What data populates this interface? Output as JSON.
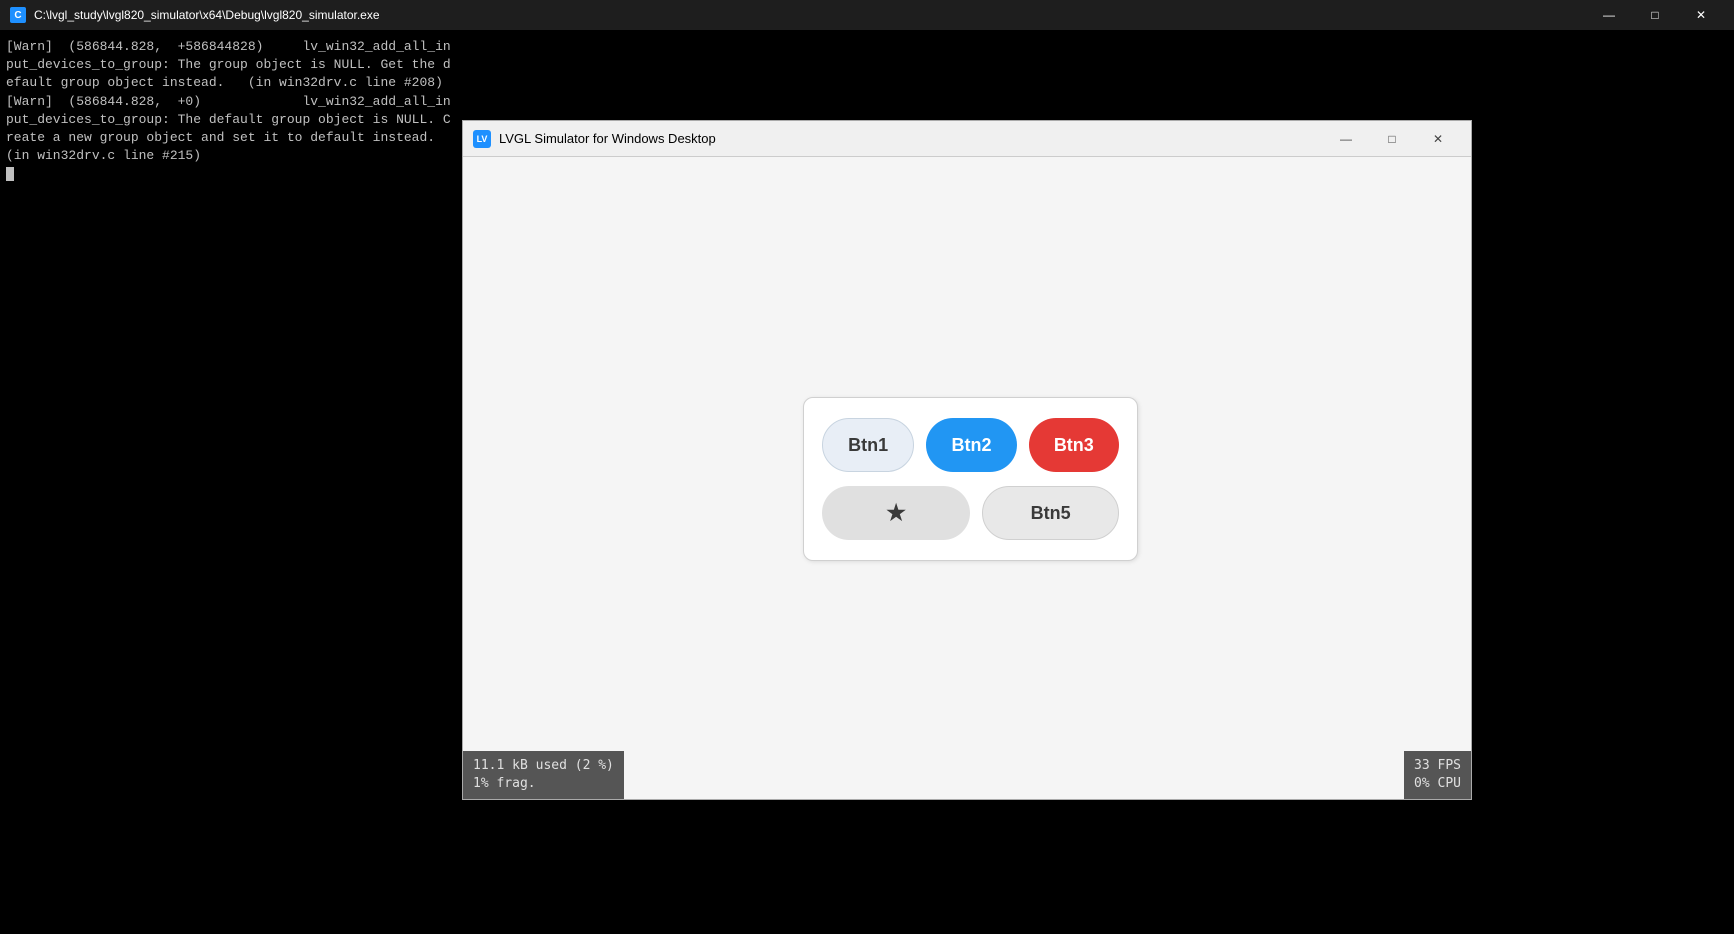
{
  "console": {
    "titlebar": {
      "icon_text": "C",
      "title": "C:\\lvgl_study\\lvgl820_simulator\\x64\\Debug\\lvgl820_simulator.exe",
      "minimize": "—",
      "maximize": "□",
      "close": "✕"
    },
    "lines": [
      "[Warn]  (586844.828,  +586844828)     lv_win32_add_all_input_devices_to_group: The group object is NULL. Get the default group object instead.   (in win32drv.c line #208)",
      "[Warn]  (586844.828,  +0)             lv_win32_add_all_input_devices_to_group: The default group object is NULL. Create a new group object and set it to default instead.   (in win32drv.c line #215)"
    ]
  },
  "simulator": {
    "titlebar": {
      "icon_text": "LV",
      "title": "LVGL Simulator for Windows Desktop",
      "minimize": "—",
      "maximize": "□",
      "close": "✕"
    },
    "buttons": {
      "btn1_label": "Btn1",
      "btn2_label": "Btn2",
      "btn3_label": "Btn3",
      "btn4_label": "★",
      "btn5_label": "Btn5"
    },
    "statusbar": {
      "mem_line1": "11.1 kB used (2 %)",
      "mem_line2": "1% frag.",
      "fps_line1": "33 FPS",
      "fps_line2": "0% CPU"
    }
  }
}
